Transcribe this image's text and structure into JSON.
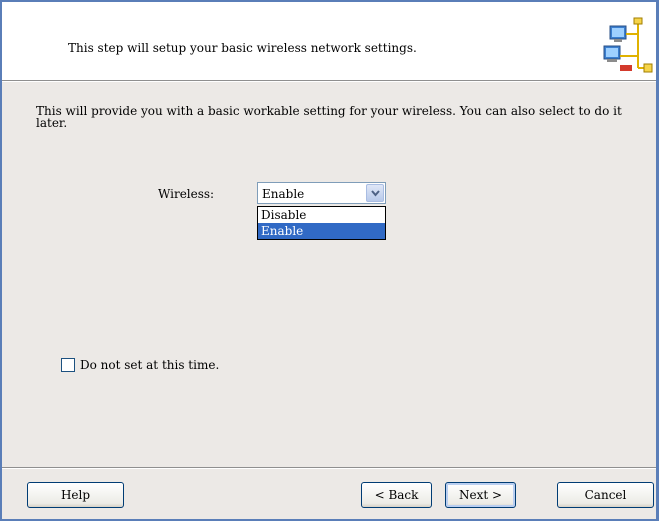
{
  "header": {
    "text": "This step will setup your basic wireless network settings.",
    "icon": "network-computers-icon"
  },
  "body": {
    "description": "This will provide you with a basic workable setting for your wireless. You can also select to do it later.",
    "wireless": {
      "label": "Wireless:",
      "selected": "Enable",
      "options": [
        "Disable",
        "Enable"
      ],
      "highlighted": "Enable"
    },
    "skip_checkbox": {
      "label": "Do not set at this time.",
      "checked": false
    }
  },
  "footer": {
    "help": "Help",
    "back": "< Back",
    "next": "Next >",
    "cancel": "Cancel"
  },
  "colors": {
    "border": "#5a7eb8",
    "dialog_bg": "#ece9e6",
    "selection": "#316ac5"
  }
}
